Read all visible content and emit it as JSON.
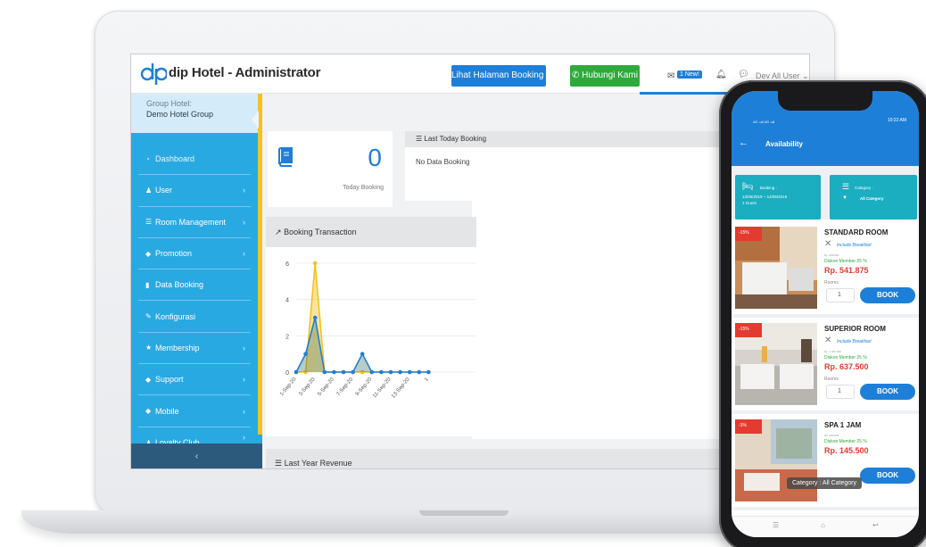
{
  "admin": {
    "app_title": "dip Hotel - Administrator",
    "btn_booking": "Lihat Halaman Booking",
    "btn_call": "Hubungi Kami",
    "new_badge": "1 New!",
    "user": "Dev All User",
    "group_label": "Group Hotel:",
    "group_name": "Demo Hotel Group",
    "menu": [
      {
        "label": "Dashboard",
        "icon": "dashboard-icon",
        "chevron": false
      },
      {
        "label": "User",
        "icon": "user-icon",
        "chevron": true
      },
      {
        "label": "Room Management",
        "icon": "list-icon",
        "chevron": true
      },
      {
        "label": "Promotion",
        "icon": "tag-icon",
        "chevron": true
      },
      {
        "label": "Data Booking",
        "icon": "book-icon",
        "chevron": false
      },
      {
        "label": "Konfigurasi",
        "icon": "wrench-icon",
        "chevron": false
      },
      {
        "label": "Membership",
        "icon": "star-icon",
        "chevron": true
      },
      {
        "label": "Support",
        "icon": "tag-icon",
        "chevron": true
      },
      {
        "label": "Mobile",
        "icon": "tag-icon",
        "chevron": true
      },
      {
        "label": "Loyalty Club",
        "icon": "user-icon",
        "chevron": true
      }
    ],
    "today_count": "0",
    "today_label": "Today Booking",
    "last_booking_title": "Last Today Booking",
    "last_booking_body": "No Data Booking T",
    "chart_title": "Booking Transaction",
    "revenue_title": "Last Year Revenue"
  },
  "chart_data": {
    "type": "area",
    "title": "Booking Transaction",
    "x": [
      "1-Sep-20",
      "2-Sep-20",
      "3-Sep-20",
      "4-Sep-20",
      "5-Sep-20",
      "6-Sep-20",
      "7-Sep-20",
      "8-Sep-20",
      "9-Sep-20",
      "10-Sep-20",
      "11-Sep-20",
      "12-Sep-20",
      "13-Sep-20",
      "14-Sep-20",
      "15-Sep-20"
    ],
    "x_tick_labels": [
      "1-Sep-20",
      "3-Sep-20",
      "5-Sep-20",
      "7-Sep-20",
      "9-Sep-20",
      "11-Sep-20",
      "13-Sep-20",
      "1"
    ],
    "y_ticks": [
      0,
      2,
      4,
      6
    ],
    "ylim": [
      0,
      6
    ],
    "series": [
      {
        "color": "#f4c221",
        "values": [
          0,
          0,
          6,
          0,
          0,
          0,
          0,
          0,
          0,
          0,
          0,
          0,
          0,
          0,
          0
        ]
      },
      {
        "color": "#1e7fd8",
        "values": [
          0,
          1,
          3,
          0,
          0,
          0,
          0,
          1,
          0,
          0,
          0,
          0,
          0,
          0,
          0
        ]
      }
    ]
  },
  "mobile": {
    "title": "Availability",
    "status_left": "4G .ull 4G .ull",
    "status_right": "10:22 AM",
    "booking_label": "Booking :",
    "booking_dates": "13/05/2019 ~ 14/05/2019",
    "booking_guests": "1 Guest",
    "category_label": "Category :",
    "category_value": "All Category",
    "rooms": [
      {
        "discount": "-15%",
        "name": "STANDARD ROOM",
        "breakfast": "Include Breakfast",
        "orig_price": "Rp. 650.000",
        "member": "Diskon Member 25 %",
        "price": "Rp. 541.875",
        "rooms_label": "Rooms",
        "qty": "1",
        "book": "BOOK"
      },
      {
        "discount": "-15%",
        "name": "SUPERIOR ROOM",
        "breakfast": "Include Breakfast",
        "orig_price": "Rp. 1.000.000",
        "member": "Diskon Member 25 %",
        "price": "Rp. 637.500",
        "rooms_label": "Rooms",
        "qty": "1",
        "book": "BOOK"
      },
      {
        "discount": "-3%",
        "name": "SPA 1 JAM",
        "breakfast": "",
        "orig_price": "Rp. 200.000",
        "member": "Diskon Member 25 %",
        "price": "Rp. 145.500",
        "rooms_label": "",
        "qty": "",
        "book": "BOOK"
      }
    ],
    "tooltip": "Category : All Category"
  }
}
